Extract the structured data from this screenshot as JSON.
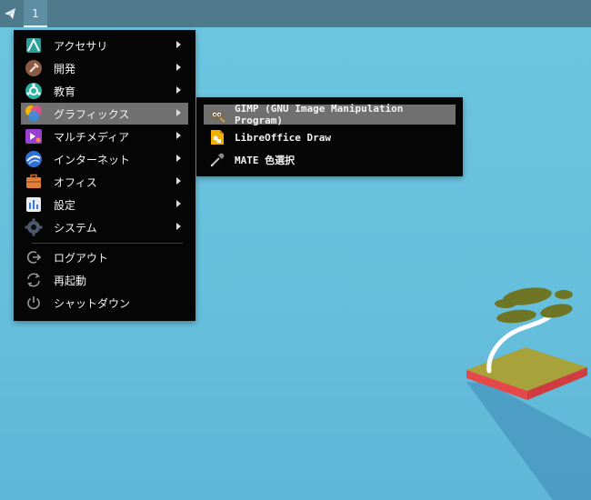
{
  "panel": {
    "workspace": "1"
  },
  "menu": {
    "items": [
      {
        "label": "アクセサリ",
        "icon": "accessories-icon"
      },
      {
        "label": "開発",
        "icon": "development-icon"
      },
      {
        "label": "教育",
        "icon": "education-icon"
      },
      {
        "label": "グラフィックス",
        "icon": "graphics-icon"
      },
      {
        "label": "マルチメディア",
        "icon": "multimedia-icon"
      },
      {
        "label": "インターネット",
        "icon": "internet-icon"
      },
      {
        "label": "オフィス",
        "icon": "office-icon"
      },
      {
        "label": "設定",
        "icon": "settings-icon"
      },
      {
        "label": "システム",
        "icon": "system-icon"
      }
    ],
    "actions": [
      {
        "label": "ログアウト",
        "icon": "logout-icon"
      },
      {
        "label": "再起動",
        "icon": "restart-icon"
      },
      {
        "label": "シャットダウン",
        "icon": "shutdown-icon"
      }
    ],
    "active_index": 3
  },
  "submenu": {
    "items": [
      {
        "label": "GIMP (GNU Image Manipulation Program)",
        "icon": "gimp-icon"
      },
      {
        "label": "LibreOffice Draw",
        "icon": "libreoffice-draw-icon"
      },
      {
        "label": "MATE 色選択",
        "icon": "color-picker-icon"
      }
    ]
  },
  "colors": {
    "accent": "#707070",
    "menu_bg": "#050505",
    "panel_bg": "#4f7a8c"
  }
}
